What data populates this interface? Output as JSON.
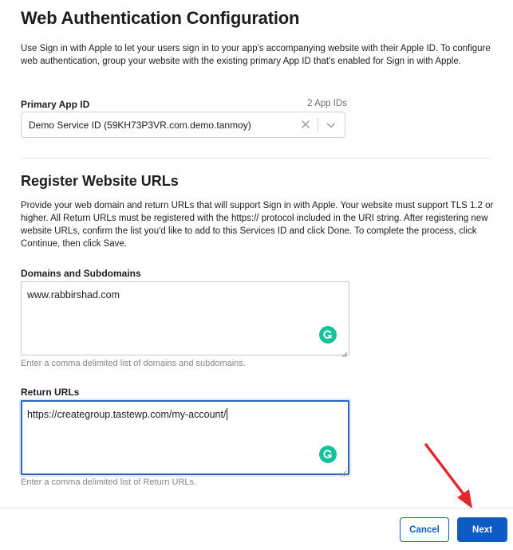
{
  "page": {
    "title": "Web Authentication Configuration",
    "description": "Use Sign in with Apple to let your users sign in to your app's accompanying website with their Apple ID. To configure web authentication, group your website with the existing primary App ID that's enabled for Sign in with Apple."
  },
  "primary_app": {
    "label": "Primary App ID",
    "count": "2 App IDs",
    "selected_value": "Demo Service ID (59KH73P3VR.com.demo.tanmoy)",
    "clear_icon": "close-icon",
    "dropdown_icon": "chevron-down-icon"
  },
  "register": {
    "title": "Register Website URLs",
    "description": "Provide your web domain and return URLs that will support Sign in with Apple. Your website must support TLS 1.2 or higher. All Return URLs must be registered with the https:// protocol included in the URI string. After registering new website URLs, confirm the list you'd like to add to this Services ID and click Done. To complete the process, click Continue, then click Save."
  },
  "domains": {
    "label": "Domains and Subdomains",
    "value": "www.rabbirshad.com",
    "hint": "Enter a comma delimited list of domains and subdomains.",
    "assist_icon": "grammarly-icon"
  },
  "return_urls": {
    "label": "Return URLs",
    "value": "https://creategroup.tastewp.com/my-account/",
    "hint": "Enter a comma delimited list of Return URLs.",
    "assist_icon": "grammarly-icon"
  },
  "footer": {
    "cancel_label": "Cancel",
    "next_label": "Next"
  },
  "annotation": {
    "arrow_color": "#e3262b",
    "arrow_icon": "red-arrow-annotation"
  },
  "colors": {
    "accent": "#0d5cc4",
    "focus_border": "#2b66c4",
    "grammarly": "#15c39a"
  }
}
